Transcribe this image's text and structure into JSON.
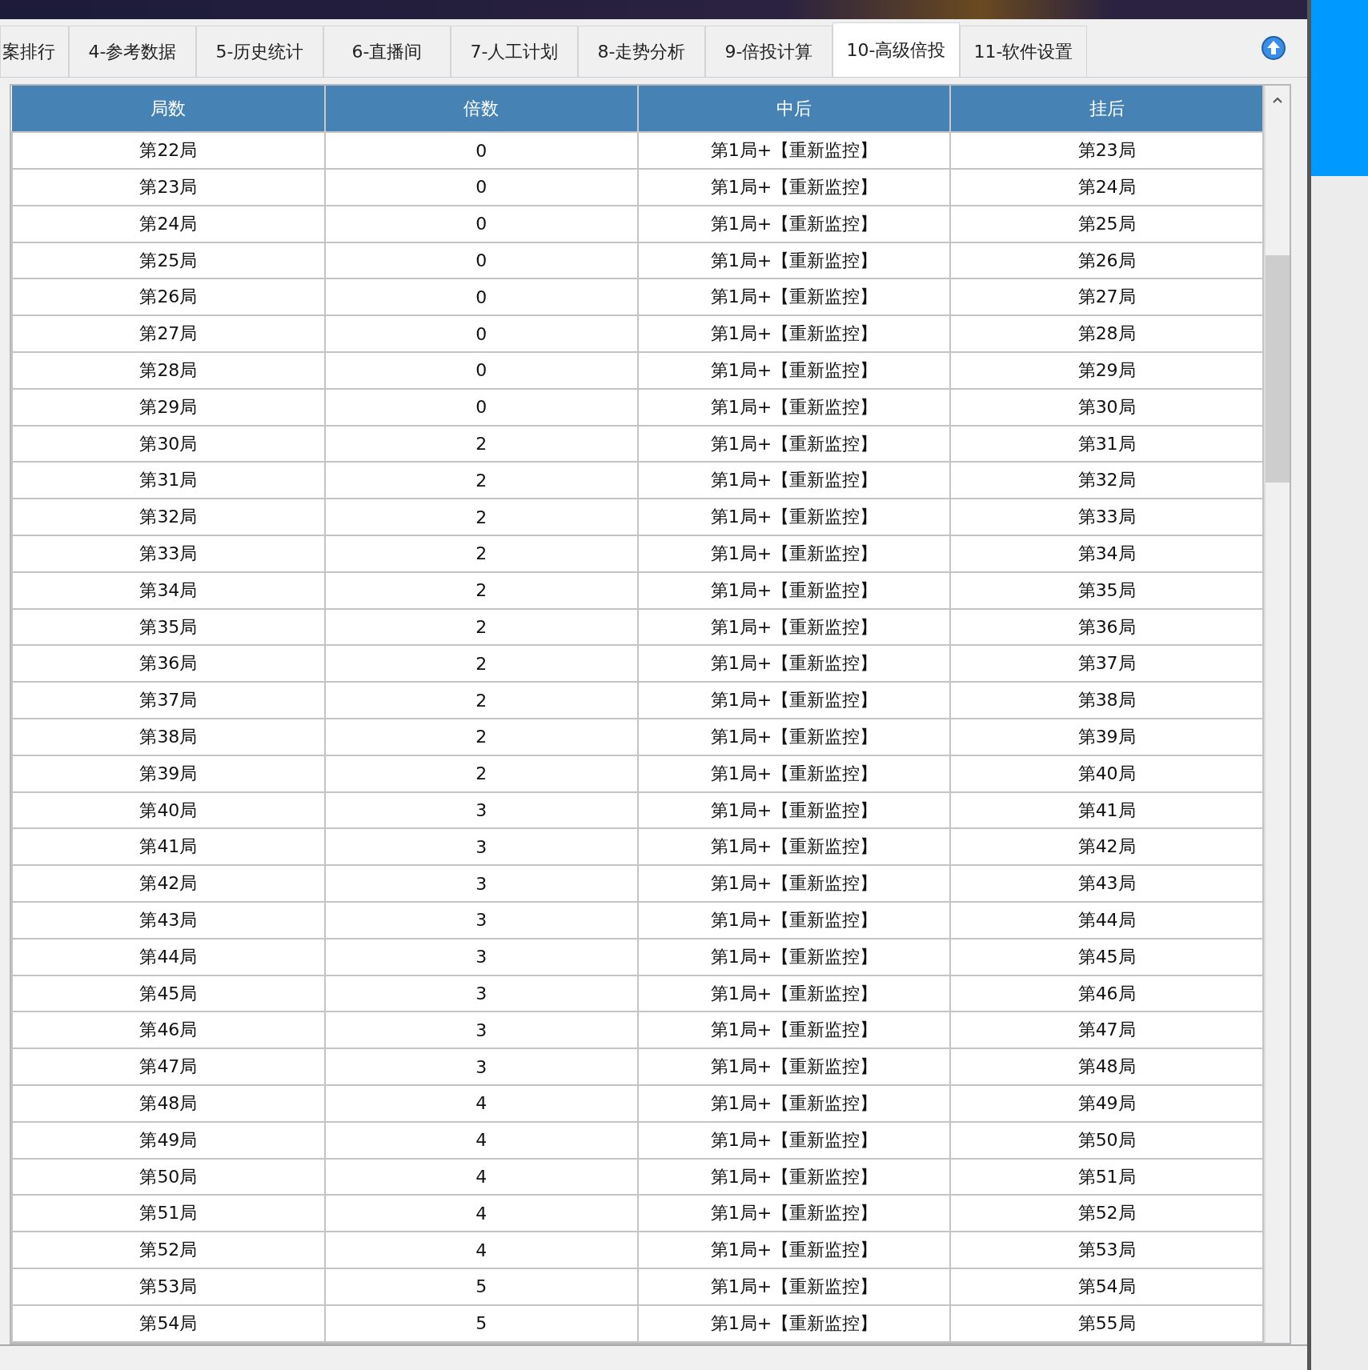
{
  "tabs": [
    {
      "label": "案排行",
      "selected": false
    },
    {
      "label": "4-参考数据",
      "selected": false
    },
    {
      "label": "5-历史统计",
      "selected": false
    },
    {
      "label": "6-直播间",
      "selected": false
    },
    {
      "label": "7-人工计划",
      "selected": false
    },
    {
      "label": "8-走势分析",
      "selected": false
    },
    {
      "label": "9-倍投计算",
      "selected": false
    },
    {
      "label": "10-高级倍投",
      "selected": true
    },
    {
      "label": "11-软件设置",
      "selected": false
    }
  ],
  "table": {
    "columns": [
      "局数",
      "倍数",
      "中后",
      "挂后"
    ],
    "rows": [
      [
        "第22局",
        "0",
        "第1局+【重新监控】",
        "第23局"
      ],
      [
        "第23局",
        "0",
        "第1局+【重新监控】",
        "第24局"
      ],
      [
        "第24局",
        "0",
        "第1局+【重新监控】",
        "第25局"
      ],
      [
        "第25局",
        "0",
        "第1局+【重新监控】",
        "第26局"
      ],
      [
        "第26局",
        "0",
        "第1局+【重新监控】",
        "第27局"
      ],
      [
        "第27局",
        "0",
        "第1局+【重新监控】",
        "第28局"
      ],
      [
        "第28局",
        "0",
        "第1局+【重新监控】",
        "第29局"
      ],
      [
        "第29局",
        "0",
        "第1局+【重新监控】",
        "第30局"
      ],
      [
        "第30局",
        "2",
        "第1局+【重新监控】",
        "第31局"
      ],
      [
        "第31局",
        "2",
        "第1局+【重新监控】",
        "第32局"
      ],
      [
        "第32局",
        "2",
        "第1局+【重新监控】",
        "第33局"
      ],
      [
        "第33局",
        "2",
        "第1局+【重新监控】",
        "第34局"
      ],
      [
        "第34局",
        "2",
        "第1局+【重新监控】",
        "第35局"
      ],
      [
        "第35局",
        "2",
        "第1局+【重新监控】",
        "第36局"
      ],
      [
        "第36局",
        "2",
        "第1局+【重新监控】",
        "第37局"
      ],
      [
        "第37局",
        "2",
        "第1局+【重新监控】",
        "第38局"
      ],
      [
        "第38局",
        "2",
        "第1局+【重新监控】",
        "第39局"
      ],
      [
        "第39局",
        "2",
        "第1局+【重新监控】",
        "第40局"
      ],
      [
        "第40局",
        "3",
        "第1局+【重新监控】",
        "第41局"
      ],
      [
        "第41局",
        "3",
        "第1局+【重新监控】",
        "第42局"
      ],
      [
        "第42局",
        "3",
        "第1局+【重新监控】",
        "第43局"
      ],
      [
        "第43局",
        "3",
        "第1局+【重新监控】",
        "第44局"
      ],
      [
        "第44局",
        "3",
        "第1局+【重新监控】",
        "第45局"
      ],
      [
        "第45局",
        "3",
        "第1局+【重新监控】",
        "第46局"
      ],
      [
        "第46局",
        "3",
        "第1局+【重新监控】",
        "第47局"
      ],
      [
        "第47局",
        "3",
        "第1局+【重新监控】",
        "第48局"
      ],
      [
        "第48局",
        "4",
        "第1局+【重新监控】",
        "第49局"
      ],
      [
        "第49局",
        "4",
        "第1局+【重新监控】",
        "第50局"
      ],
      [
        "第50局",
        "4",
        "第1局+【重新监控】",
        "第51局"
      ],
      [
        "第51局",
        "4",
        "第1局+【重新监控】",
        "第52局"
      ],
      [
        "第52局",
        "4",
        "第1局+【重新监控】",
        "第53局"
      ],
      [
        "第53局",
        "5",
        "第1局+【重新监控】",
        "第54局"
      ],
      [
        "第54局",
        "5",
        "第1局+【重新监控】",
        "第55局"
      ]
    ]
  }
}
